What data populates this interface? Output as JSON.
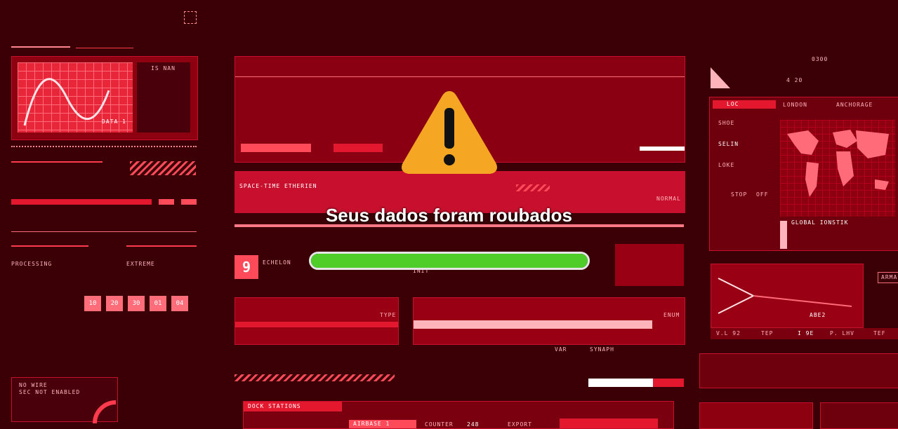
{
  "alert": {
    "message": "Seus dados foram roubados",
    "progress": 1.0,
    "icon": "warning-triangle-icon"
  },
  "hud": {
    "top_right_label": "IS NAN",
    "data_label": "DATA 1",
    "space_time_label": "SPACE-TIME ETHERIEN",
    "normal_label": "NORMAL",
    "echelon_number": "9",
    "echelon_label": "ECHELON",
    "init_label": "INIT",
    "type_label": "TYPE",
    "enum_label": "ENUM",
    "var_label": "VAR",
    "synaph_label": "SYNAPH",
    "dock_label": "DOCK STATIONS",
    "airbase_label": "AIRBASE 1",
    "counter_label": "COUNTER",
    "counter_value": "248",
    "export_label": "EXPORT",
    "processing_label": "PROCESSING",
    "extreme_label": "EXTREME",
    "no_wire": "NO WIRE",
    "sec_label": "SEC NOT ENABLED",
    "time_boxes": [
      "10",
      "20",
      "30",
      "01",
      "04"
    ],
    "loc_label": "LOC",
    "london_label": "LONDON",
    "anchorage_label": "ANCHORAGE",
    "side_items": [
      "SHOE",
      "SELIN",
      "LOKE"
    ],
    "stop_label": "STOP",
    "off_label": "OFF",
    "global_label": "GLOBAL IONSTIK",
    "coord_a": "4 20",
    "coord_b": "0300",
    "aber_label": "ABE2",
    "arm_label": "ARMA",
    "bottom_right_labels": [
      "V.L 92",
      "TEP",
      "I 9E",
      "P. LHV",
      "TEF"
    ],
    "colors": {
      "accent": "#ff3b4d",
      "background": "#3a0006",
      "progress": "#4fcd28",
      "warning": "#f5a623"
    }
  }
}
